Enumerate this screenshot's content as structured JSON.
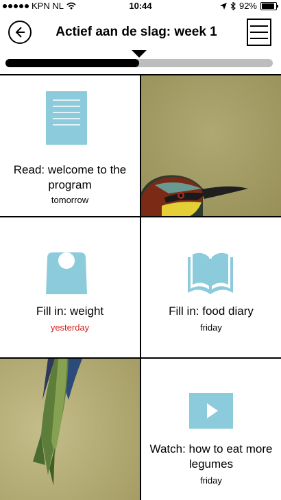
{
  "status_bar": {
    "carrier": "KPN NL",
    "time": "10:44",
    "battery": "92%"
  },
  "header": {
    "title": "Actief aan de slag: week 1",
    "back_icon": "arrow-left-circle-icon",
    "menu_icon": "hamburger-menu-icon"
  },
  "progress": {
    "value": 0.5
  },
  "tiles": [
    {
      "label": "Read: welcome to the program",
      "sub": "tomorrow",
      "icon": "document-icon",
      "icon_color": "#8ccbdb"
    },
    {
      "image": "bird-head-photo"
    },
    {
      "label": "Fill in: weight",
      "sub": "yesterday",
      "sub_color": "#d61f1f",
      "icon": "weight-scale-icon",
      "icon_color": "#8ccbdb"
    },
    {
      "label": "Fill in: food diary",
      "sub": "friday",
      "icon": "open-book-icon",
      "icon_color": "#8ccbdb"
    },
    {
      "image": "bird-tail-photo"
    },
    {
      "label": "Watch: how to eat more legumes",
      "sub": "friday",
      "icon": "play-video-icon",
      "icon_color": "#8ccbdb"
    }
  ]
}
